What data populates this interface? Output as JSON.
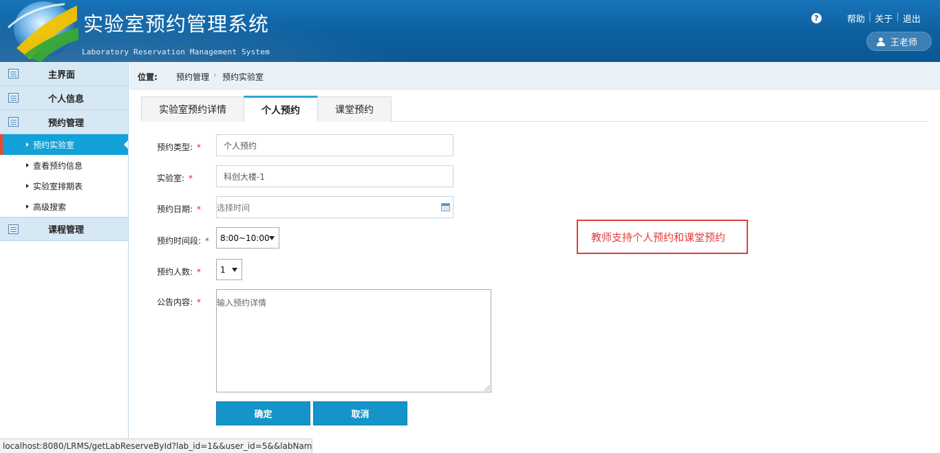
{
  "header": {
    "title": "实验室预约管理系统",
    "subtitle": "Laboratory Reservation Management System",
    "help_icon_text": "?",
    "links": [
      "帮助",
      "关于",
      "退出"
    ],
    "user_name": "王老师",
    "colors": {
      "header_bg": "#0c5f9e",
      "accent": "#12a1d8"
    }
  },
  "sidebar": {
    "sections": [
      {
        "label": "主界面"
      },
      {
        "label": "个人信息"
      },
      {
        "label": "预约管理"
      }
    ],
    "sub_items": [
      {
        "label": "预约实验室",
        "active": true
      },
      {
        "label": "查看预约信息"
      },
      {
        "label": "实验室排期表"
      },
      {
        "label": "高级搜索"
      }
    ],
    "course_section": {
      "label": "课程管理"
    }
  },
  "breadcrumb": {
    "location_label": "位置:",
    "items": [
      "预约管理",
      "预约实验室"
    ],
    "separator": "›"
  },
  "tabs": [
    {
      "label": "实验室预约详情"
    },
    {
      "label": "个人预约",
      "active": true
    },
    {
      "label": "课堂预约"
    }
  ],
  "form": {
    "type": {
      "label": "预约类型:",
      "value": "个人预约"
    },
    "lab": {
      "label": "实验室:",
      "value": "科创大楼-1"
    },
    "date": {
      "label": "预约日期:",
      "placeholder": "选择时间"
    },
    "slot": {
      "label": "预约时间段:",
      "value": "8:00~10:00"
    },
    "count": {
      "label": "预约人数:",
      "value": "1"
    },
    "content": {
      "label": "公告内容:",
      "placeholder": "输入预约详情"
    },
    "required_mark": "*",
    "confirm_label": "确定",
    "cancel_label": "取消"
  },
  "annotation": {
    "text": "教师支持个人预约和课堂预约",
    "color": "#e23b3b"
  },
  "status_bar": {
    "url": "localhost:8080/LRMS/getLabReserveById?lab_id=1&&user_id=5&&labNam..."
  }
}
